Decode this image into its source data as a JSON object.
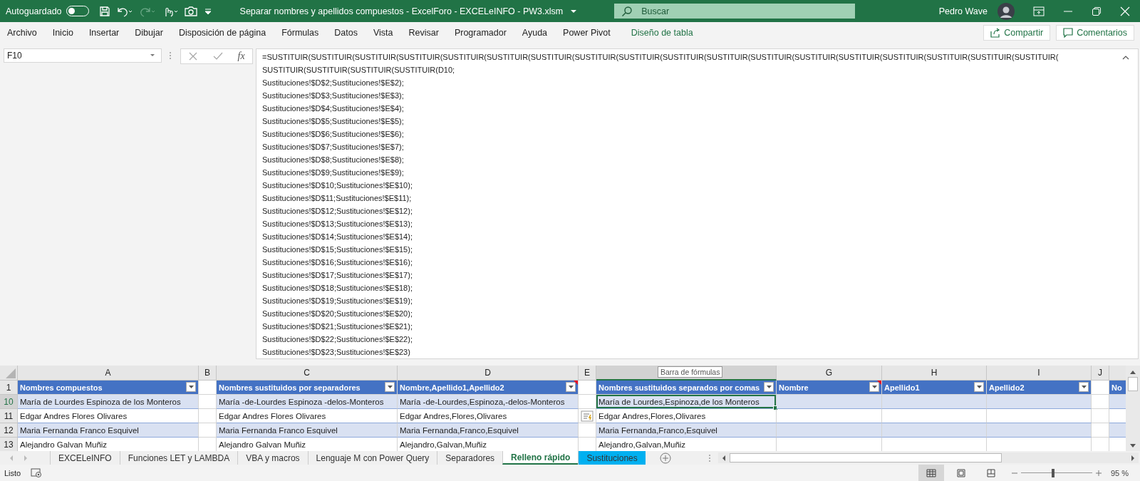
{
  "title_bar": {
    "autosave_label": "Autoguardado",
    "autosave_on": false,
    "document_title": "Separar nombres y apellidos compuestos - ExcelForo - EXCELeINFO - PW3.xlsm",
    "search_placeholder": "Buscar",
    "user_name": "Pedro Wave"
  },
  "ribbon": {
    "tabs": [
      {
        "label": "Archivo",
        "kind": "normal"
      },
      {
        "label": "Inicio",
        "kind": "normal"
      },
      {
        "label": "Insertar",
        "kind": "normal"
      },
      {
        "label": "Dibujar",
        "kind": "normal"
      },
      {
        "label": "Disposición de página",
        "kind": "normal"
      },
      {
        "label": "Fórmulas",
        "kind": "normal"
      },
      {
        "label": "Datos",
        "kind": "normal"
      },
      {
        "label": "Vista",
        "kind": "normal"
      },
      {
        "label": "Revisar",
        "kind": "normal"
      },
      {
        "label": "Programador",
        "kind": "normal"
      },
      {
        "label": "Ayuda",
        "kind": "normal"
      },
      {
        "label": "Power Pivot",
        "kind": "normal"
      },
      {
        "label": "Diseño de tabla",
        "kind": "contextual"
      }
    ],
    "share_button": "Compartir",
    "comments_button": "Comentarios"
  },
  "formula_bar": {
    "name_box": "F10",
    "function_button": "fx",
    "lines": [
      "=SUSTITUIR(SUSTITUIR(SUSTITUIR(SUSTITUIR(SUSTITUIR(SUSTITUIR(SUSTITUIR(SUSTITUIR(SUSTITUIR(SUSTITUIR(SUSTITUIR(SUSTITUIR(SUSTITUIR(SUSTITUIR(SUSTITUIR(SUSTITUIR(SUSTITUIR(SUSTITUIR(",
      "SUSTITUIR(SUSTITUIR(SUSTITUIR(SUSTITUIR(D10;",
      "Sustituciones!$D$2;Sustituciones!$E$2);",
      "Sustituciones!$D$3;Sustituciones!$E$3);",
      "Sustituciones!$D$4;Sustituciones!$E$4);",
      "Sustituciones!$D$5;Sustituciones!$E$5);",
      "Sustituciones!$D$6;Sustituciones!$E$6);",
      "Sustituciones!$D$7;Sustituciones!$E$7);",
      "Sustituciones!$D$8;Sustituciones!$E$8);",
      "Sustituciones!$D$9;Sustituciones!$E$9);",
      "Sustituciones!$D$10;Sustituciones!$E$10);",
      "Sustituciones!$D$11;Sustituciones!$E$11);",
      "Sustituciones!$D$12;Sustituciones!$E$12);",
      "Sustituciones!$D$13;Sustituciones!$E$13);",
      "Sustituciones!$D$14;Sustituciones!$E$14);",
      "Sustituciones!$D$15;Sustituciones!$E$15);",
      "Sustituciones!$D$16;Sustituciones!$E$16);",
      "Sustituciones!$D$17;Sustituciones!$E$17);",
      "Sustituciones!$D$18;Sustituciones!$E$18);",
      "Sustituciones!$D$19;Sustituciones!$E$19);",
      "Sustituciones!$D$20;Sustituciones!$E$20);",
      "Sustituciones!$D$21;Sustituciones!$E$21);",
      "Sustituciones!$D$22;Sustituciones!$E$22);",
      "Sustituciones!$D$23;Sustituciones!$E$23)"
    ]
  },
  "tooltip": "Barra de fórmulas",
  "sheet": {
    "columns": [
      {
        "letter": "A",
        "header": "Nombres compuestos",
        "filter": true,
        "comment": false
      },
      {
        "letter": "B"
      },
      {
        "letter": "C",
        "header": "Nombres sustituidos por separadores",
        "filter": true,
        "comment": false
      },
      {
        "letter": "D",
        "header": "Nombre,Apellido1,Apellido2",
        "filter": true,
        "comment": true
      },
      {
        "letter": "E"
      },
      {
        "header": "Nombres sustituidos separados por comas",
        "filter": true,
        "comment": false,
        "selected": true
      },
      {
        "letter": "G",
        "header": "Nombre",
        "filter": true,
        "comment": true,
        "selected": false
      },
      {
        "letter": "H",
        "header": "Apellido1",
        "filter": true,
        "comment": false,
        "selected": false
      },
      {
        "letter": "I",
        "header": "Apellido2",
        "filter": true,
        "comment": false,
        "selected": false
      },
      {
        "letter": "J"
      },
      {
        "header": "No",
        "filter": false,
        "comment": false,
        "selected": false
      }
    ],
    "header_row_number": "1",
    "rows": [
      {
        "number": "10",
        "selected": true,
        "cells": [
          "María de Lourdes Espinoza de los Monteros",
          "",
          "María -de-Lourdes Espinoza -delos-Monteros",
          "María -de-Lourdes,Espinoza,-delos-Monteros",
          "",
          "María de Lourdes,Espinoza,de los Monteros"
        ]
      },
      {
        "number": "11",
        "selected": false,
        "cells": [
          "Edgar Andres Flores Olivares",
          "",
          "Edgar Andres Flores Olivares",
          "Edgar Andres,Flores,Olivares",
          "",
          "Edgar Andres,Flores,Olivares"
        ]
      },
      {
        "number": "12",
        "selected": false,
        "cells": [
          "Maria Fernanda Franco Esquivel",
          "",
          "Maria Fernanda Franco Esquivel",
          "Maria Fernanda,Franco,Esquivel",
          "",
          "Maria Fernanda,Franco,Esquivel"
        ]
      },
      {
        "number": "13",
        "selected": false,
        "cells": [
          "Alejandro Galvan Muñiz",
          "",
          "Alejandro Galvan Muñiz",
          "Alejandro,Galvan,Muñiz",
          "",
          "Alejandro,Galvan,Muñiz"
        ]
      }
    ]
  },
  "sheet_tabs": [
    {
      "label": "EXCELeINFO",
      "selected": false
    },
    {
      "label": "Funciones LET y LAMBDA",
      "selected": false
    },
    {
      "label": "VBA y macros",
      "selected": false
    },
    {
      "label": "Lenguaje M con Power Query",
      "selected": false
    },
    {
      "label": "Separadores",
      "selected": false
    },
    {
      "label": "Relleno rápido",
      "selected": true
    },
    {
      "label": "Sustituciones",
      "selected": false,
      "color": "#00b0f0"
    }
  ],
  "status_bar": {
    "status": "Listo",
    "zoom": "95 %",
    "zoom_slider": {
      "level": 0.45
    }
  }
}
